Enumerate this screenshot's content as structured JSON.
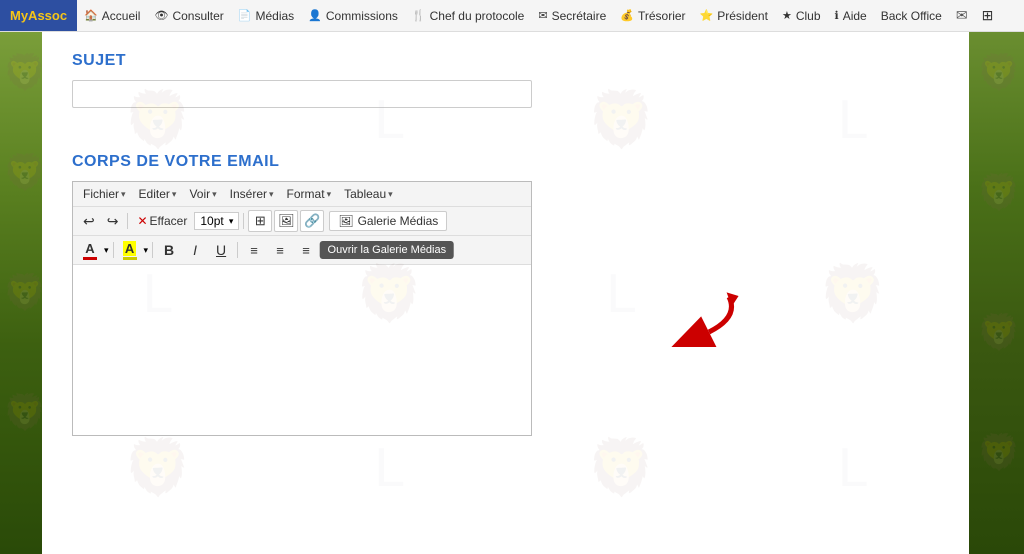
{
  "brand": "MyAssoc",
  "navbar": {
    "items": [
      {
        "id": "accueil",
        "icon": "🏠",
        "label": "Accueil"
      },
      {
        "id": "consulter",
        "icon": "👁",
        "label": "Consulter"
      },
      {
        "id": "medias",
        "icon": "📄",
        "label": "Médias"
      },
      {
        "id": "commissions",
        "icon": "👤",
        "label": "Commissions"
      },
      {
        "id": "chef-protocole",
        "icon": "🍴",
        "label": "Chef du protocole"
      },
      {
        "id": "secretaire",
        "icon": "✉",
        "label": "Secrétaire"
      },
      {
        "id": "tresorier",
        "icon": "💰",
        "label": "Trésorier"
      },
      {
        "id": "president",
        "icon": "⭐",
        "label": "Président"
      },
      {
        "id": "club",
        "icon": "★",
        "label": "Club"
      },
      {
        "id": "aide",
        "icon": "ℹ",
        "label": "Aide"
      },
      {
        "id": "backoffice",
        "icon": "",
        "label": "Back Office"
      }
    ]
  },
  "subject": {
    "label": "SUJET",
    "placeholder": ""
  },
  "body_section": {
    "label": "CORPS DE VOTRE EMAIL"
  },
  "editor": {
    "menu_items": [
      {
        "id": "fichier",
        "label": "Fichier"
      },
      {
        "id": "editer",
        "label": "Editer"
      },
      {
        "id": "voir",
        "label": "Voir"
      },
      {
        "id": "inserer",
        "label": "Insérer"
      },
      {
        "id": "format",
        "label": "Format"
      },
      {
        "id": "tableau",
        "label": "Tableau"
      }
    ],
    "toolbar": {
      "undo": "↩",
      "redo": "↪",
      "clear_label": "Effacer",
      "fontsize": "10pt",
      "galerie_label": "Galerie Médias",
      "tooltip": "Ouvrir la Galerie Médias"
    },
    "format_toolbar": {
      "font_color": "A",
      "bg_color": "A",
      "bold": "B",
      "italic": "I",
      "underline": "U"
    }
  }
}
